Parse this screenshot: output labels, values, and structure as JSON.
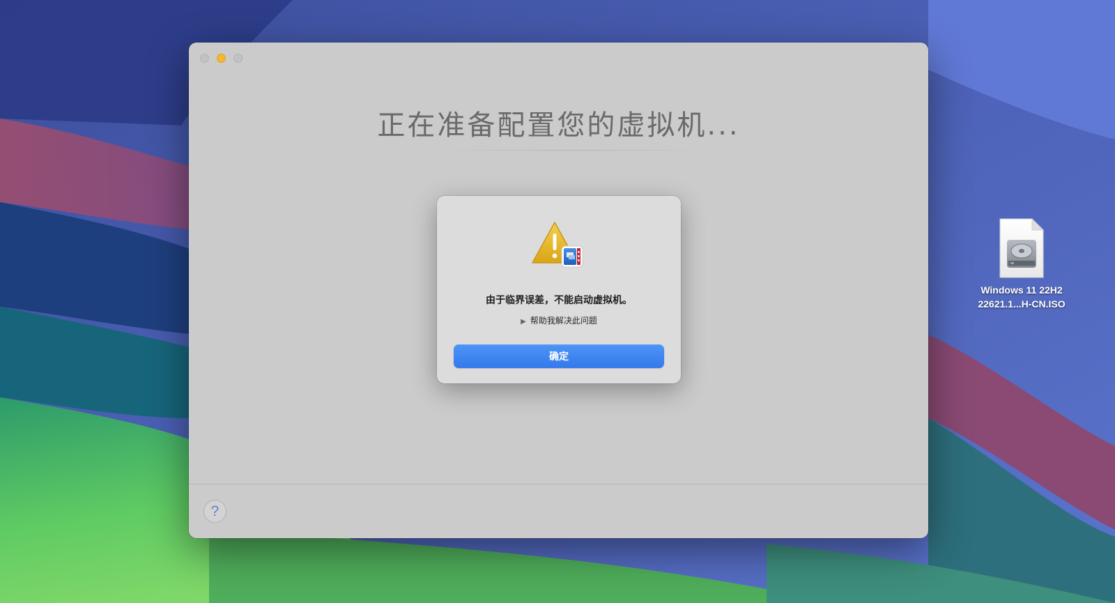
{
  "window": {
    "title": "正在准备配置您的虚拟机...",
    "traffic_light_colors": {
      "close": "#c2c2c2",
      "minimize": "#f4b731",
      "zoom": "#c2c2c2"
    },
    "help_label": "?"
  },
  "dialog": {
    "icon": "warning-triangle-icon",
    "message": "由于临界误差，不能启动虚拟机。",
    "disclosure_label": "帮助我解决此问题",
    "ok_label": "确定",
    "accent_color": "#3b82f0"
  },
  "desktop": {
    "file": {
      "icon": "disk-image-icon",
      "name_line_1": "Windows 11 22H2",
      "name_line_2": "22621.1...H-CN.ISO"
    }
  }
}
